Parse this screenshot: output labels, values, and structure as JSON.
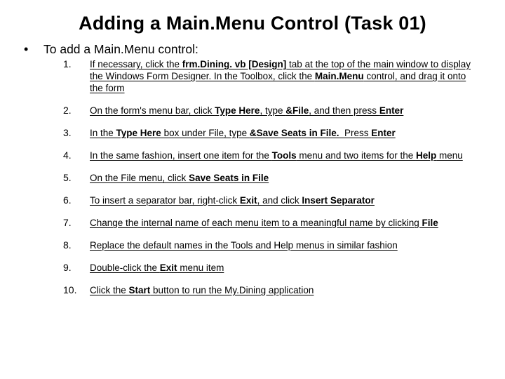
{
  "title": "Adding a Main.Menu Control (Task 01)",
  "bullet": "•",
  "lead": "To add a Main.Menu control:",
  "steps": [
    {
      "num": "1.",
      "html": "If necessary, click the <span class='b'>frm.Dining. vb [Design]</span> tab at the top of the main window to display the Windows Form Designer. In the Toolbox, click the <span class='b'>Main.Menu</span> control, and drag it onto the form"
    },
    {
      "num": "2.",
      "html": "On the form's menu bar, click <span class='b'>Type Here</span>, type <span class='b'>&amp;File</span>, and then press <span class='b'>Enter</span>"
    },
    {
      "num": "3.",
      "html": "In the <span class='b'>Type Here</span> box under File, type <span class='b'>&amp;Save Seats in File.</span>&nbsp; Press <span class='b'>Enter</span>"
    },
    {
      "num": "4.",
      "html": "In the same fashion, insert one item for the <span class='b'>Tools</span> menu and two items for the <span class='b'>Help</span> menu"
    },
    {
      "num": "5.",
      "html": "On the File menu, click <span class='b'>Save Seats in File</span>"
    },
    {
      "num": "6.",
      "html": "To insert a separator bar, right-click <span class='b'>Exit</span>, and click <span class='b'>Insert Separator</span>"
    },
    {
      "num": "7.",
      "html": "Change the internal name of each menu item to a meaningful name by clicking <span class='b'>File</span>"
    },
    {
      "num": "8.",
      "html": "Replace the default names in the Tools and Help menus in similar fashion"
    },
    {
      "num": "9.",
      "html": "Double-click the <span class='b'>Exit</span> menu item"
    },
    {
      "num": "10.",
      "html": "Click the <span class='b'>Start</span> button to run the My.Dining application"
    }
  ]
}
